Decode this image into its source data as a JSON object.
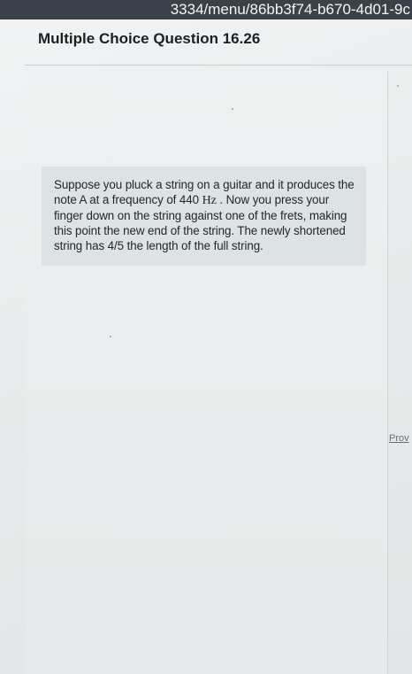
{
  "browser": {
    "url_fragment": "3334/menu/86bb3f74-b670-4d01-9c"
  },
  "header": {
    "title": "Multiple Choice Question 16.26"
  },
  "question": {
    "text_before_unit": "Suppose you pluck a string on a guitar and it produces the note A at a frequency of 440 ",
    "unit": "Hz",
    "text_after_unit": " . Now you press your finger down on the string against one of the frets, making this point the new end of the string. The newly shortened string has 4/5 the length of the full string."
  },
  "sidebar": {
    "partial_link": "Prov"
  }
}
